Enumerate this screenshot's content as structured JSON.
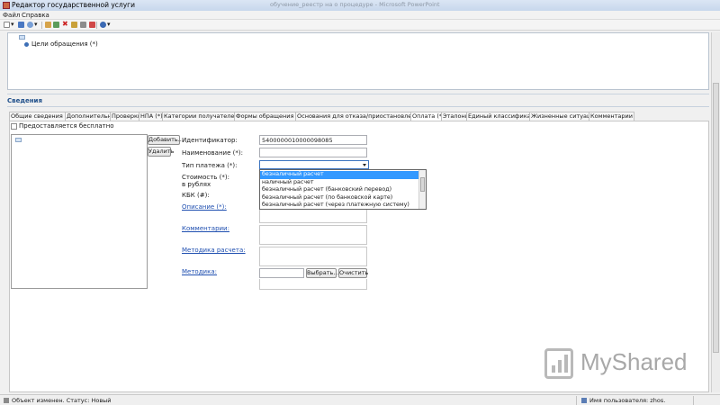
{
  "window": {
    "title": "Редактор государственной услуги",
    "background_title": "обучение_реестр на о процедуре - Microsoft PowerPoint"
  },
  "menu": [
    "Файл",
    "Справка"
  ],
  "tree": {
    "node_label": "Цели обращения (*)"
  },
  "section": {
    "title": "Сведения"
  },
  "tabs": [
    "Общие сведения (*)",
    "Дополнительно",
    "Проверки",
    "НПА (*)",
    "Категории получателей (*)",
    "Формы обращения (*)",
    "Основания для отказа/приостановления(*)",
    "Оплата (*)",
    "Эталоны",
    "Единый классификатор",
    "Жизненные ситуации",
    "Комментарии"
  ],
  "active_tab_index": 7,
  "form": {
    "free_checkbox_label": "Предоставляется бесплатно",
    "add_button": "Добавить...",
    "delete_button": "Удалить",
    "identifier_label": "Идентификатор:",
    "identifier_value": "5400000010000098085",
    "name_label": "Наименование (*):",
    "payment_type_label": "Тип платежа (*):",
    "cost_label_1": "Стоимость (*):",
    "cost_label_2": "в рублях",
    "kbk_label": "КБК (#):",
    "description_label": "Описание (*):",
    "comments_label": "Комментарии:",
    "calc_method_label": "Методика расчета:",
    "method_label": "Методика:",
    "choose_button": "Выбрать...",
    "clear_button": "Очистить"
  },
  "dropdown": {
    "options": [
      "безналичный расчет",
      "наличный расчет",
      "безналичный расчет (банковский перевод)",
      "безналичный расчет (по банковской карте)",
      "безналичный расчет (через платежную систему)"
    ],
    "selected_index": 0
  },
  "status": {
    "left": "Объект изменен. Статус: Новый",
    "user": "Имя пользователя: zhos."
  },
  "watermark": {
    "text": "MyShared"
  }
}
